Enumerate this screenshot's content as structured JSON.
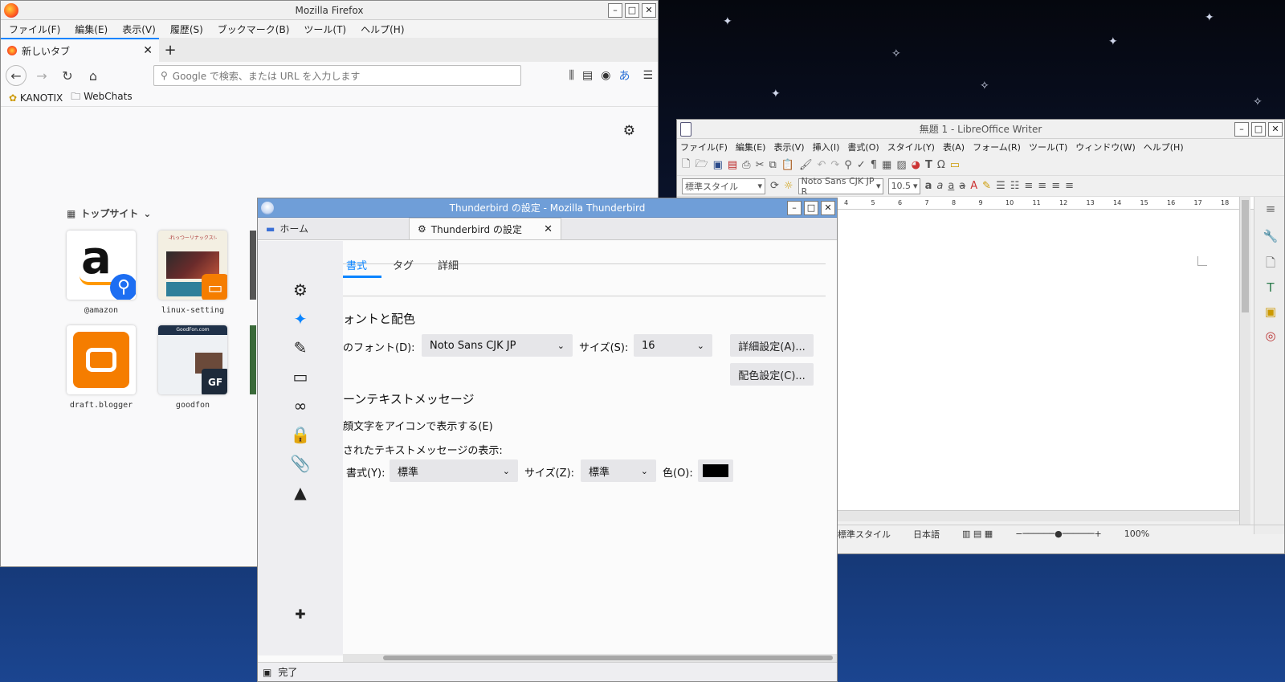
{
  "firefox": {
    "title": "Mozilla Firefox",
    "menu": [
      "ファイル(F)",
      "編集(E)",
      "表示(V)",
      "履歴(S)",
      "ブックマーク(B)",
      "ツール(T)",
      "ヘルプ(H)"
    ],
    "tab_label": "新しいタブ",
    "url_placeholder": "Google で検索、または URL を入力します",
    "bookmarks": [
      "KANOTIX",
      "WebChats"
    ],
    "topsites_header": "トップサイト",
    "tiles": [
      {
        "label": "@amazon"
      },
      {
        "label": "linux-setting"
      },
      {
        "label": "draft.blogger"
      },
      {
        "label": "goodfon"
      }
    ],
    "thumb_texts": {
      "linux_banner": "-れっつーリナックス!-",
      "goodfon_banner": "GoodFon.com",
      "gf_badge": "GF"
    }
  },
  "thunderbird": {
    "title": "Thunderbird の設定 - Mozilla Thunderbird",
    "tabs": [
      "ホーム",
      "Thunderbird の設定"
    ],
    "pane_tabs": [
      "書式",
      "タグ",
      "詳細"
    ],
    "fonts_heading": "ォントと配色",
    "default_font_label": "のフォント(D):",
    "default_font_value": "Noto Sans CJK JP",
    "size_label": "サイズ(S):",
    "size_value": "16",
    "advanced_button": "詳細設定(A)...",
    "colors_button": "配色設定(C)...",
    "plaintext_heading": "ーンテキストメッセージ",
    "emoticon_label": "顔文字をアイコンで表示する(E)",
    "quoted_label": "されたテキストメッセージの表示:",
    "style_label": "書式(Y):",
    "style_value": "標準",
    "qsize_label": "サイズ(Z):",
    "qsize_value": "標準",
    "color_label": "色(O):",
    "status": "完了",
    "colors": {
      "accent": "#0a84ff",
      "titlebar": "#6f9ed8",
      "swatch": "#000000"
    }
  },
  "writer": {
    "title": "無題 1 - LibreOffice Writer",
    "menu": [
      "ファイル(F)",
      "編集(E)",
      "表示(V)",
      "挿入(I)",
      "書式(O)",
      "スタイル(Y)",
      "表(A)",
      "フォーム(R)",
      "ツール(T)",
      "ウィンドウ(W)",
      "ヘルプ(H)"
    ],
    "para_style": "標準スタイル",
    "font_name": "Noto Sans CJK JP R",
    "font_size": "10.5",
    "ruler_ticks": [
      "4",
      "5",
      "6",
      "7",
      "8",
      "9",
      "10",
      "11",
      "12",
      "13",
      "14",
      "15",
      "16",
      "17",
      "18"
    ],
    "status_style": "標準スタイル",
    "status_lang": "日本語",
    "zoom": "100%"
  }
}
